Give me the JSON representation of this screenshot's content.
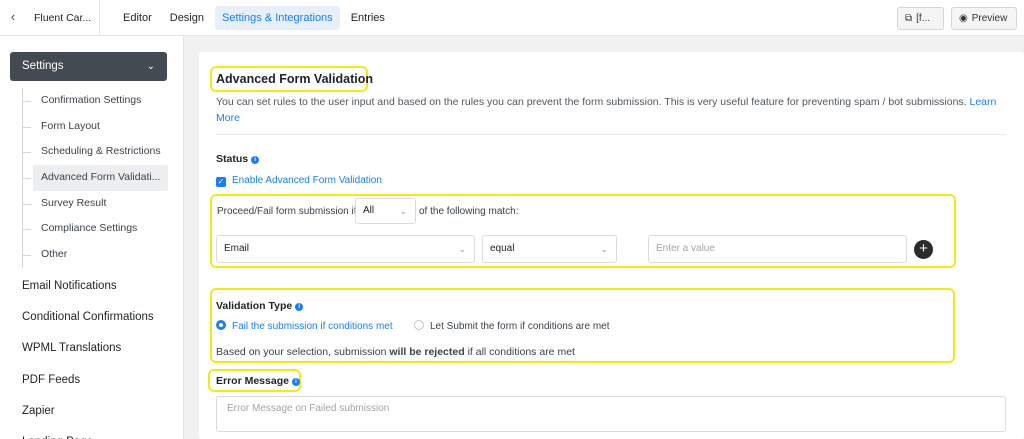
{
  "topbar": {
    "back_icon": "chevron-left-icon",
    "form_name": "Fluent Car...",
    "tabs": [
      {
        "label": "Editor",
        "active": false
      },
      {
        "label": "Design",
        "active": false
      },
      {
        "label": "Settings & Integrations",
        "active": true
      },
      {
        "label": "Entries",
        "active": false
      }
    ],
    "shortcode_label": "[f...",
    "preview_label": "Preview"
  },
  "sidebar": {
    "header": "Settings",
    "sub_items": [
      {
        "label": "Confirmation Settings",
        "active": false
      },
      {
        "label": "Form Layout",
        "active": false
      },
      {
        "label": "Scheduling & Restrictions",
        "active": false
      },
      {
        "label": "Advanced Form Validati...",
        "active": true
      },
      {
        "label": "Survey Result",
        "active": false
      },
      {
        "label": "Compliance Settings",
        "active": false
      },
      {
        "label": "Other",
        "active": false
      }
    ],
    "main_items": [
      "Email Notifications",
      "Conditional Confirmations",
      "WPML Translations",
      "PDF Feeds",
      "Zapier",
      "Landing Page"
    ]
  },
  "main": {
    "title": "Advanced Form Validation",
    "description": "You can set rules to the user input and based on the rules you can prevent the form submission. This is very useful feature for preventing spam / bot submissions.",
    "learn_more": "Learn More",
    "status_label": "Status",
    "enable_label": "Enable Advanced Form Validation",
    "condition": {
      "prefix": "Proceed/Fail form submission if",
      "match_value": "All",
      "suffix": "of the following match:",
      "field_value": "Email",
      "operator_value": "equal",
      "value_placeholder": "Enter a value"
    },
    "validation_type_label": "Validation Type",
    "options": [
      {
        "label": "Fail the submission if conditions met",
        "selected": true
      },
      {
        "label": "Let Submit the form if conditions are met",
        "selected": false
      }
    ],
    "note_prefix": "Based on your selection, submission",
    "note_bold": "will be rejected",
    "note_suffix": "if all conditions are met",
    "error_label": "Error Message",
    "error_placeholder": "Error Message on Failed submission"
  },
  "colors": {
    "accent": "#1a7efb",
    "highlight": "#f1e91b",
    "sidebar_header": "#444a52"
  }
}
